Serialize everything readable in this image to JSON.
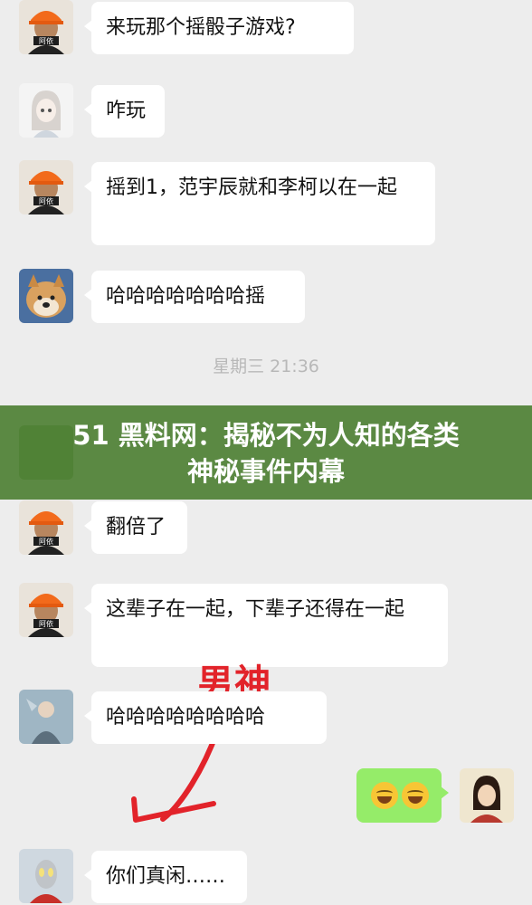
{
  "messages": [
    {
      "sender": "hardhat-man",
      "caption": "阿依",
      "text": "来玩那个摇骰子游戏?"
    },
    {
      "sender": "anime-girl",
      "text": "咋玩"
    },
    {
      "sender": "hardhat-man",
      "caption": "阿依",
      "text": "摇到1，范宇辰就和李柯以在一起"
    },
    {
      "sender": "shiba-dog",
      "text": "哈哈哈哈哈哈哈摇"
    },
    {
      "sender": "hardhat-man",
      "caption": "阿依",
      "text": "翻倍了"
    },
    {
      "sender": "hardhat-man",
      "caption": "阿依",
      "text": "这辈子在一起，下辈子还得在一起"
    },
    {
      "sender": "figure-avatar",
      "text": "哈哈哈哈哈哈哈哈"
    },
    {
      "sender": "self",
      "text": "😂😂"
    },
    {
      "sender": "ultraman",
      "text": "你们真闲……"
    }
  ],
  "timestamp": "星期三 21:36",
  "banner": {
    "line1": "51 黑料网：揭秘不为人知的各类",
    "line2": "神秘事件内幕"
  },
  "annotation": "男神",
  "colors": {
    "background": "#ededed",
    "bubble_other": "#ffffff",
    "bubble_self": "#95ec69",
    "banner": "#4e8034",
    "annotation": "#e2232a"
  }
}
